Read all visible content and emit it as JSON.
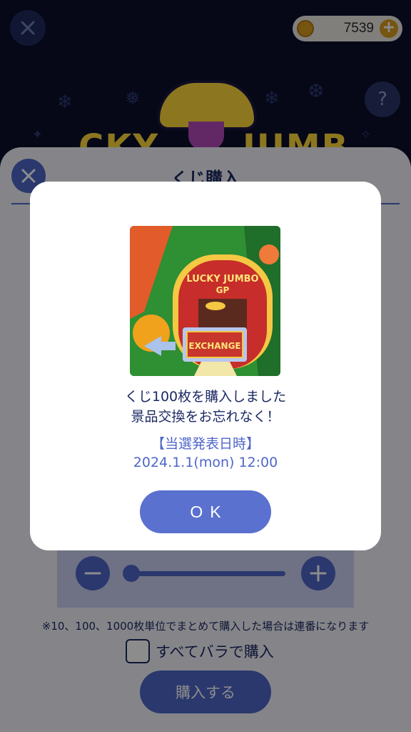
{
  "header": {
    "close_icon": "close-icon",
    "coins": "7539",
    "coin_icon": "coin-icon",
    "add_coins_icon": "plus-icon",
    "help_label": "?",
    "logo_left": "CKY",
    "logo_right": "JUMB"
  },
  "sheet": {
    "title": "くじ購入",
    "close_icon": "close-icon",
    "note": "※10、100、1000枚単位でまとめて購入した場合は連番になります",
    "bara_label": "すべてバラで購入",
    "buy_label": "購入する",
    "minus_icon": "minus-icon",
    "plus_icon": "plus-icon"
  },
  "modal": {
    "image_sign": "LUCKY JUMBO",
    "image_sign_sub": "GP",
    "image_exchange": "EXCHANGE",
    "message_line1": "くじ100枚を購入しました",
    "message_line2": "景品交換をお忘れなく！",
    "announce_heading": "【当選発表日時】",
    "announce_datetime": "2024.1.1(mon) 12:00",
    "ok_label": "OK"
  },
  "colors": {
    "navy_bg": "#0b0f2b",
    "accent_blue": "#4f66c9",
    "text_navy": "#1c2a63",
    "coin_gold": "#d79b1f"
  }
}
